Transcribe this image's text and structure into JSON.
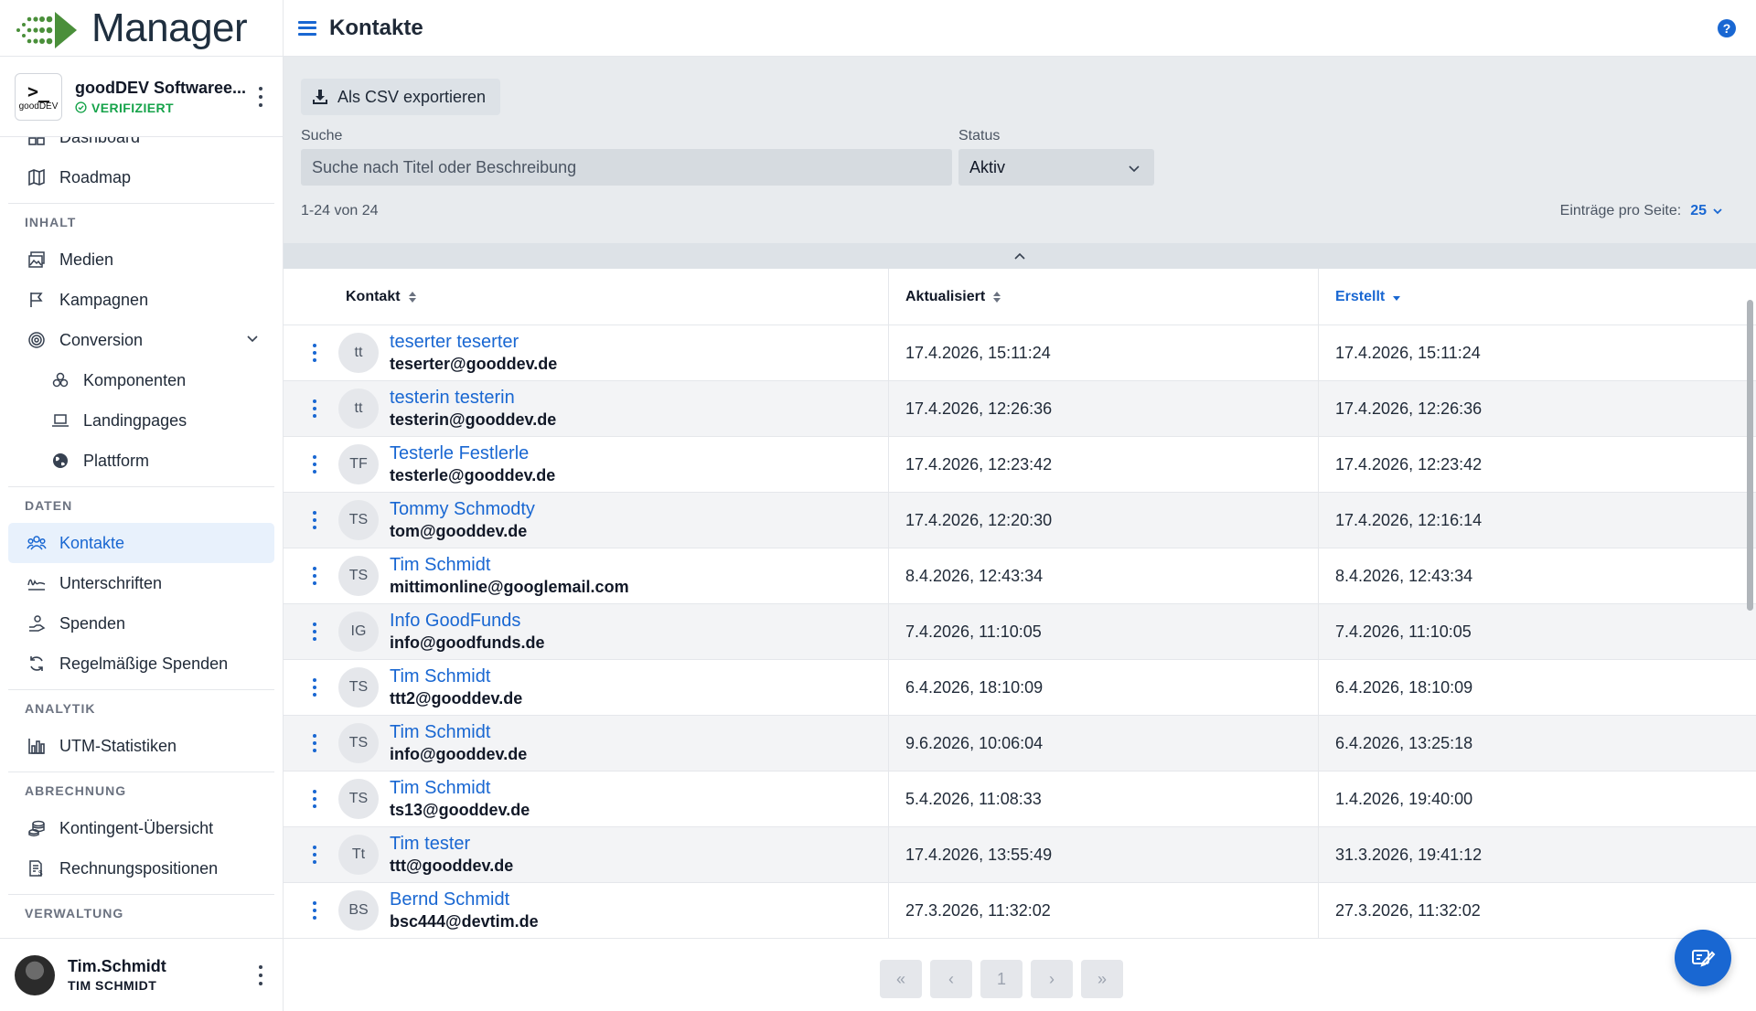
{
  "app": {
    "name": "Manager"
  },
  "org": {
    "name": "goodDEV Softwaree...",
    "badge": "VERIFIZIERT",
    "logo_prompt": ">_",
    "logo_small": "goodDEV"
  },
  "nav": {
    "clipped_item": "Dashboard",
    "top_items": [
      {
        "label": "Roadmap",
        "icon": "map-icon"
      }
    ],
    "sections": [
      {
        "title": "INHALT",
        "items": [
          {
            "label": "Medien",
            "icon": "media-icon"
          },
          {
            "label": "Kampagnen",
            "icon": "flag-icon"
          },
          {
            "label": "Conversion",
            "icon": "target-icon",
            "expandable": true
          },
          {
            "label": "Komponenten",
            "icon": "components-icon",
            "sub": true
          },
          {
            "label": "Landingpages",
            "icon": "laptop-icon",
            "sub": true
          },
          {
            "label": "Plattform",
            "icon": "globe-icon",
            "sub": true
          }
        ]
      },
      {
        "title": "DATEN",
        "items": [
          {
            "label": "Kontakte",
            "icon": "contacts-icon",
            "active": true
          },
          {
            "label": "Unterschriften",
            "icon": "signature-icon"
          },
          {
            "label": "Spenden",
            "icon": "donation-icon"
          },
          {
            "label": "Regelmäßige Spenden",
            "icon": "recurring-icon"
          }
        ]
      },
      {
        "title": "ANALYTIK",
        "items": [
          {
            "label": "UTM-Statistiken",
            "icon": "chart-icon"
          }
        ]
      },
      {
        "title": "ABRECHNUNG",
        "items": [
          {
            "label": "Kontingent-Übersicht",
            "icon": "coins-icon"
          },
          {
            "label": "Rechnungspositionen",
            "icon": "invoice-icon"
          }
        ]
      },
      {
        "title": "VERWALTUNG",
        "items": []
      }
    ]
  },
  "user": {
    "name": "Tim.Schmidt",
    "sub": "TIM SCHMIDT"
  },
  "header": {
    "title": "Kontakte",
    "help": "?"
  },
  "filters": {
    "export_label": "Als CSV exportieren",
    "search_label": "Suche",
    "search_placeholder": "Suche nach Titel oder Beschreibung",
    "status_label": "Status",
    "status_value": "Aktiv",
    "count": "1-24 von 24",
    "per_page_label": "Einträge pro Seite:",
    "per_page_value": "25"
  },
  "table": {
    "columns": {
      "contact": "Kontakt",
      "updated": "Aktualisiert",
      "created": "Erstellt"
    },
    "rows": [
      {
        "initials": "tt",
        "name": "teserter teserter",
        "email": "teserter@gooddev.de",
        "updated": "17.4.2026, 15:11:24",
        "created": "17.4.2026, 15:11:24"
      },
      {
        "initials": "tt",
        "name": "testerin testerin",
        "email": "testerin@gooddev.de",
        "updated": "17.4.2026, 12:26:36",
        "created": "17.4.2026, 12:26:36"
      },
      {
        "initials": "TF",
        "name": "Testerle Festlerle",
        "email": "testerle@gooddev.de",
        "updated": "17.4.2026, 12:23:42",
        "created": "17.4.2026, 12:23:42"
      },
      {
        "initials": "TS",
        "name": "Tommy Schmodty",
        "email": "tom@gooddev.de",
        "updated": "17.4.2026, 12:20:30",
        "created": "17.4.2026, 12:16:14"
      },
      {
        "initials": "TS",
        "name": "Tim Schmidt",
        "email": "mittimonline@googlemail.com",
        "updated": "8.4.2026, 12:43:34",
        "created": "8.4.2026, 12:43:34"
      },
      {
        "initials": "IG",
        "name": "Info GoodFunds",
        "email": "info@goodfunds.de",
        "updated": "7.4.2026, 11:10:05",
        "created": "7.4.2026, 11:10:05"
      },
      {
        "initials": "TS",
        "name": "Tim Schmidt",
        "email": "ttt2@gooddev.de",
        "updated": "6.4.2026, 18:10:09",
        "created": "6.4.2026, 18:10:09"
      },
      {
        "initials": "TS",
        "name": "Tim Schmidt",
        "email": "info@gooddev.de",
        "updated": "9.6.2026, 10:06:04",
        "created": "6.4.2026, 13:25:18"
      },
      {
        "initials": "TS",
        "name": "Tim Schmidt",
        "email": "ts13@gooddev.de",
        "updated": "5.4.2026, 11:08:33",
        "created": "1.4.2026, 19:40:00"
      },
      {
        "initials": "Tt",
        "name": "Tim tester",
        "email": "ttt@gooddev.de",
        "updated": "17.4.2026, 13:55:49",
        "created": "31.3.2026, 19:41:12"
      },
      {
        "initials": "BS",
        "name": "Bernd Schmidt",
        "email": "bsc444@devtim.de",
        "updated": "27.3.2026, 11:32:02",
        "created": "27.3.2026, 11:32:02"
      }
    ]
  },
  "pagination": {
    "first": "«",
    "prev": "‹",
    "page": "1",
    "next": "›",
    "last": "»"
  },
  "colors": {
    "accent": "#1967d2",
    "verified": "#16a34a"
  }
}
